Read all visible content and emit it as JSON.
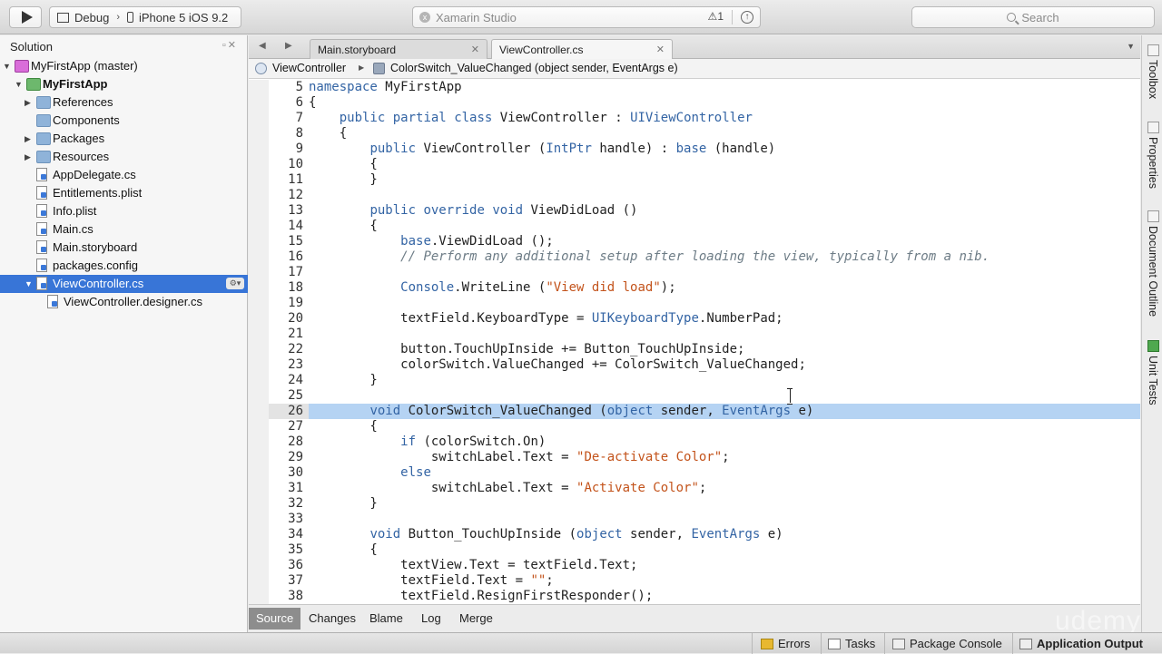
{
  "toolbar": {
    "config": "Debug",
    "device": "iPhone 5 iOS 9.2",
    "status_title": "Xamarin Studio",
    "warning_count": "1",
    "search_placeholder": "Search"
  },
  "solution": {
    "title": "Solution",
    "items": [
      {
        "label": "MyFirstApp (master)",
        "indent": 0,
        "expanded": true,
        "icon": "solution-icon"
      },
      {
        "label": "MyFirstApp",
        "indent": 1,
        "expanded": true,
        "icon": "project-icon",
        "bold": true
      },
      {
        "label": "References",
        "indent": 2,
        "collapsed": true,
        "icon": "folder-icon"
      },
      {
        "label": "Components",
        "indent": 2,
        "icon": "folder-icon"
      },
      {
        "label": "Packages",
        "indent": 2,
        "collapsed": true,
        "icon": "folder-icon"
      },
      {
        "label": "Resources",
        "indent": 2,
        "collapsed": true,
        "icon": "folder-icon"
      },
      {
        "label": "AppDelegate.cs",
        "indent": 2,
        "icon": "file-icon"
      },
      {
        "label": "Entitlements.plist",
        "indent": 2,
        "icon": "file-icon"
      },
      {
        "label": "Info.plist",
        "indent": 2,
        "icon": "file-icon"
      },
      {
        "label": "Main.cs",
        "indent": 2,
        "icon": "file-icon"
      },
      {
        "label": "Main.storyboard",
        "indent": 2,
        "icon": "file-icon"
      },
      {
        "label": "packages.config",
        "indent": 2,
        "icon": "file-icon"
      },
      {
        "label": "ViewController.cs",
        "indent": 2,
        "expanded": true,
        "icon": "file-icon",
        "selected": true
      },
      {
        "label": "ViewController.designer.cs",
        "indent": 3,
        "icon": "file-icon"
      }
    ]
  },
  "tabs": [
    {
      "label": "Main.storyboard"
    },
    {
      "label": "ViewController.cs"
    }
  ],
  "pathbar": {
    "class_name": "ViewController",
    "member_name": "ColorSwitch_ValueChanged (object sender, EventArgs e)"
  },
  "code": {
    "highlighted_line": 26,
    "lines": [
      {
        "n": "5",
        "text": "namespace MyFirstApp"
      },
      {
        "n": "6",
        "text": "{"
      },
      {
        "n": "7",
        "text": "    public partial class ViewController : UIViewController"
      },
      {
        "n": "8",
        "text": "    {"
      },
      {
        "n": "9",
        "text": "        public ViewController (IntPtr handle) : base (handle)"
      },
      {
        "n": "10",
        "text": "        {"
      },
      {
        "n": "11",
        "text": "        }"
      },
      {
        "n": "12",
        "text": ""
      },
      {
        "n": "13",
        "text": "        public override void ViewDidLoad ()"
      },
      {
        "n": "14",
        "text": "        {"
      },
      {
        "n": "15",
        "text": "            base.ViewDidLoad ();"
      },
      {
        "n": "16",
        "text": "            // Perform any additional setup after loading the view, typically from a nib."
      },
      {
        "n": "17",
        "text": ""
      },
      {
        "n": "18",
        "text": "            Console.WriteLine (\"View did load\");"
      },
      {
        "n": "19",
        "text": ""
      },
      {
        "n": "20",
        "text": "            textField.KeyboardType = UIKeyboardType.NumberPad;"
      },
      {
        "n": "21",
        "text": ""
      },
      {
        "n": "22",
        "text": "            button.TouchUpInside += Button_TouchUpInside;"
      },
      {
        "n": "23",
        "text": "            colorSwitch.ValueChanged += ColorSwitch_ValueChanged;"
      },
      {
        "n": "24",
        "text": "        }"
      },
      {
        "n": "25",
        "text": ""
      },
      {
        "n": "26",
        "text": "        void ColorSwitch_ValueChanged (object sender, EventArgs e)"
      },
      {
        "n": "27",
        "text": "        {"
      },
      {
        "n": "28",
        "text": "            if (colorSwitch.On)"
      },
      {
        "n": "29",
        "text": "                switchLabel.Text = \"De-activate Color\";"
      },
      {
        "n": "30",
        "text": "            else"
      },
      {
        "n": "31",
        "text": "                switchLabel.Text = \"Activate Color\";"
      },
      {
        "n": "32",
        "text": "        }"
      },
      {
        "n": "33",
        "text": ""
      },
      {
        "n": "34",
        "text": "        void Button_TouchUpInside (object sender, EventArgs e)"
      },
      {
        "n": "35",
        "text": "        {"
      },
      {
        "n": "36",
        "text": "            textView.Text = textField.Text;"
      },
      {
        "n": "37",
        "text": "            textField.Text = \"\";"
      },
      {
        "n": "38",
        "text": "            textField.ResignFirstResponder();"
      }
    ]
  },
  "editor_tabs": [
    "Source",
    "Changes",
    "Blame",
    "Log",
    "Merge"
  ],
  "right_dock": [
    "Toolbox",
    "Properties",
    "Document Outline",
    "Unit Tests"
  ],
  "statusbar": {
    "errors": "Errors",
    "tasks": "Tasks",
    "package_console": "Package Console",
    "application_output": "Application Output"
  },
  "watermark": "udemy",
  "colors": {
    "selection": "#3875d7",
    "line_highlight": "#b5d3f3",
    "keyword": "#3364a4",
    "string": "#c3531b",
    "comment": "#6d7c86"
  }
}
